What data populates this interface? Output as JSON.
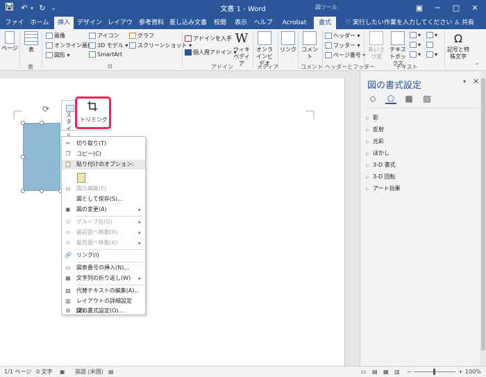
{
  "titlebar": {
    "title": "文書 1 - Word",
    "context_tools": "図ツール",
    "save_icon": "save-icon",
    "undo_icon": "undo-icon",
    "redo_icon": "redo-icon",
    "qat_icon": "customize-qat-icon"
  },
  "tabs": [
    {
      "label": "ファイル"
    },
    {
      "label": "ホーム"
    },
    {
      "label": "挿入"
    },
    {
      "label": "デザイン"
    },
    {
      "label": "レイアウト"
    },
    {
      "label": "参考資料"
    },
    {
      "label": "差し込み文書"
    },
    {
      "label": "校閲"
    },
    {
      "label": "表示"
    },
    {
      "label": "ヘルプ"
    },
    {
      "label": "Acrobat"
    },
    {
      "label": "書式"
    }
  ],
  "tellme": "実行したい作業を入力してください",
  "share": "共有",
  "ribbon": {
    "pages": "ページ",
    "table": "表",
    "table_group": "表",
    "image": "画像",
    "online_image": "オンライン画像",
    "shapes": "図形",
    "icons": "アイコン",
    "model3d": "3D モデル",
    "smartart": "SmartArt",
    "chart": "グラフ",
    "screenshot": "スクリーンショット",
    "get_addins": "アドインを入手",
    "my_addins": "個人用アドイン",
    "wikipedia": "ウィキペディア",
    "wiki_letter": "W",
    "addins_group": "アドイン",
    "online_video": "オンラインビデオ",
    "media_group": "メディア",
    "link": "リンク",
    "comment": "コメント",
    "comment_group": "コメント",
    "header": "ヘッダー",
    "footer": "フッター",
    "page_number": "ページ番号",
    "hf_group": "ヘッダーとフッター",
    "greeting": "あいさつ文",
    "textbox": "テキストボックス",
    "text_group": "テキスト",
    "symbol": "記号と特殊文字",
    "omega": "Ω"
  },
  "mini_toolbar": {
    "style_label": "スタイル",
    "trim_label": "トリミング",
    "trim_icon": "crop-icon"
  },
  "context_menu": {
    "cut": "切り取り(T)",
    "copy": "コピー(C)",
    "paste_options": "貼り付けのオプション:",
    "edit_picture": "図の編集(E)",
    "save_as_picture": "図として保存(S)...",
    "change_picture": "図の変更(A)",
    "group": "グループ化(G)",
    "bring_front": "最前面へ移動(R)",
    "send_back": "最背面へ移動(K)",
    "link": "リンク(I)",
    "insert_caption": "図表番号の挿入(N)...",
    "wrap_text": "文字列の折り返し(W)",
    "edit_alt": "代替テキストの編集(A)...",
    "more_layout": "レイアウトの詳細設定(Z)...",
    "format_picture": "図の書式設定(O)..."
  },
  "pane": {
    "title": "図の書式設定",
    "sections": [
      {
        "label": "影"
      },
      {
        "label": "反射"
      },
      {
        "label": "光彩"
      },
      {
        "label": "ぼかし"
      },
      {
        "label": "3-D 書式"
      },
      {
        "label": "3-D 回転"
      },
      {
        "label": "アート効果"
      }
    ],
    "icons": [
      "fill-line-icon",
      "effects-icon",
      "layout-properties-icon",
      "picture-icon"
    ]
  },
  "status": {
    "page": "1/1 ページ",
    "words": "0 文字",
    "language": "英語 (米国)",
    "zoom": "100%"
  }
}
